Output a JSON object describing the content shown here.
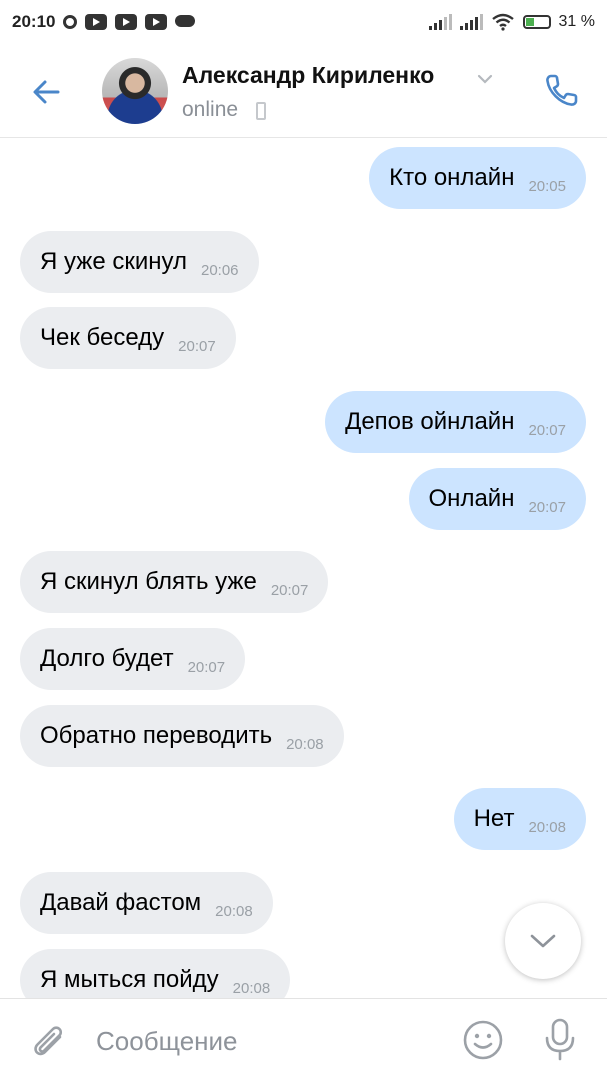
{
  "status_bar": {
    "time": "20:10",
    "battery": "31 %"
  },
  "header": {
    "contact_name": "Александр Кириленко",
    "status": "online",
    "icons": [
      "back-arrow-icon",
      "chevron-down-icon",
      "phone-icon",
      "mobile-device-icon"
    ]
  },
  "messages": [
    {
      "dir": "out",
      "text": "Кто онлайн",
      "time": "20:05"
    },
    {
      "dir": "in",
      "text": "Я уже скинул",
      "time": "20:06"
    },
    {
      "dir": "in",
      "text": "Чек беседу",
      "time": "20:07"
    },
    {
      "dir": "out",
      "text": "Депов ойнлайн",
      "time": "20:07"
    },
    {
      "dir": "out",
      "text": "Онлайн",
      "time": "20:07"
    },
    {
      "dir": "in",
      "text": "Я скинул блять уже",
      "time": "20:07"
    },
    {
      "dir": "in",
      "text": "Долго будет",
      "time": "20:07"
    },
    {
      "dir": "in",
      "text": "Обратно переводить",
      "time": "20:08"
    },
    {
      "dir": "out",
      "text": "Нет",
      "time": "20:08"
    },
    {
      "dir": "in",
      "text": "Давай фастом",
      "time": "20:08"
    },
    {
      "dir": "in",
      "text": "Я мыться пойду",
      "time": "20:08"
    }
  ],
  "composer": {
    "placeholder": "Сообщение",
    "value": ""
  },
  "colors": {
    "accent": "#4a86c9",
    "outgoing_bubble": "#cce4ff",
    "incoming_bubble": "#ebedf0",
    "muted_text": "#8a8f96"
  }
}
